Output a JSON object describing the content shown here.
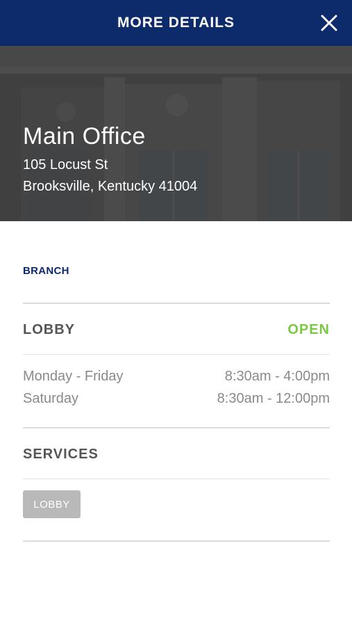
{
  "header": {
    "title": "MORE DETAILS",
    "close_icon": "close-icon"
  },
  "location": {
    "name": "Main Office",
    "address_line1": "105 Locust St",
    "address_line2": "Brooksville, Kentucky 41004",
    "type": "BRANCH"
  },
  "lobby": {
    "title": "LOBBY",
    "status": "OPEN",
    "hours": [
      {
        "days": "Monday - Friday",
        "time": "8:30am - 4:00pm"
      },
      {
        "days": "Saturday",
        "time": "8:30am - 12:00pm"
      }
    ]
  },
  "services": {
    "title": "SERVICES",
    "tags": [
      "LOBBY"
    ]
  },
  "colors": {
    "header_bg": "#0d2a6b",
    "branch_label": "#0d2a6b",
    "open_status": "#7ac943",
    "tag_bg": "#b9b9b9"
  }
}
